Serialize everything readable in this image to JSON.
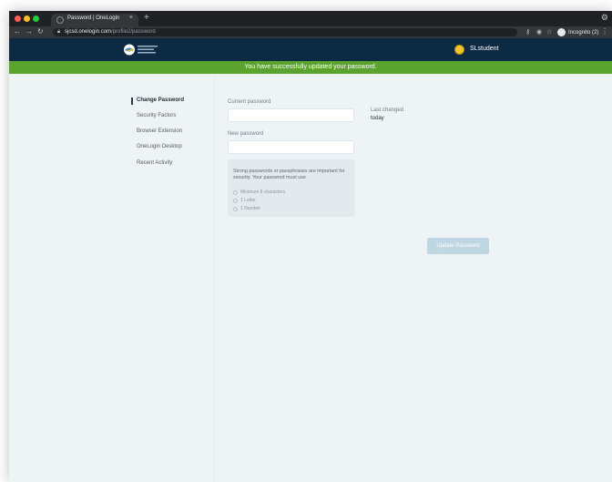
{
  "browser": {
    "tab_title": "Password | OneLogin",
    "tab_close": "×",
    "new_tab": "+",
    "url_host": "sjcsd.onelogin.com",
    "url_path": "/profile2/password",
    "incognito_label": "Incognito (2)",
    "traffic_light_colors": [
      "#ff5f57",
      "#febc2e",
      "#28c840"
    ]
  },
  "header": {
    "user_name": "SLstudent"
  },
  "banner": {
    "message": "You have successfully updated your password.",
    "color": "#5aa32f"
  },
  "sidebar": {
    "items": [
      {
        "label": "Change Password",
        "active": true
      },
      {
        "label": "Security Factors"
      },
      {
        "label": "Browser Extension"
      },
      {
        "label": "OneLogin Desktop"
      },
      {
        "label": "Recent Activity"
      }
    ]
  },
  "form": {
    "current_password_label": "Current password",
    "current_password_value": "",
    "new_password_label": "New password",
    "new_password_value": "",
    "last_changed_label": "Last changed",
    "last_changed_value": "today",
    "hint": "Strong passwords or passphrases are important for security. Your password must use",
    "requirements": [
      "Minimum 8 characters",
      "1 Letter",
      "1 Number"
    ],
    "update_button": "Update Password"
  }
}
